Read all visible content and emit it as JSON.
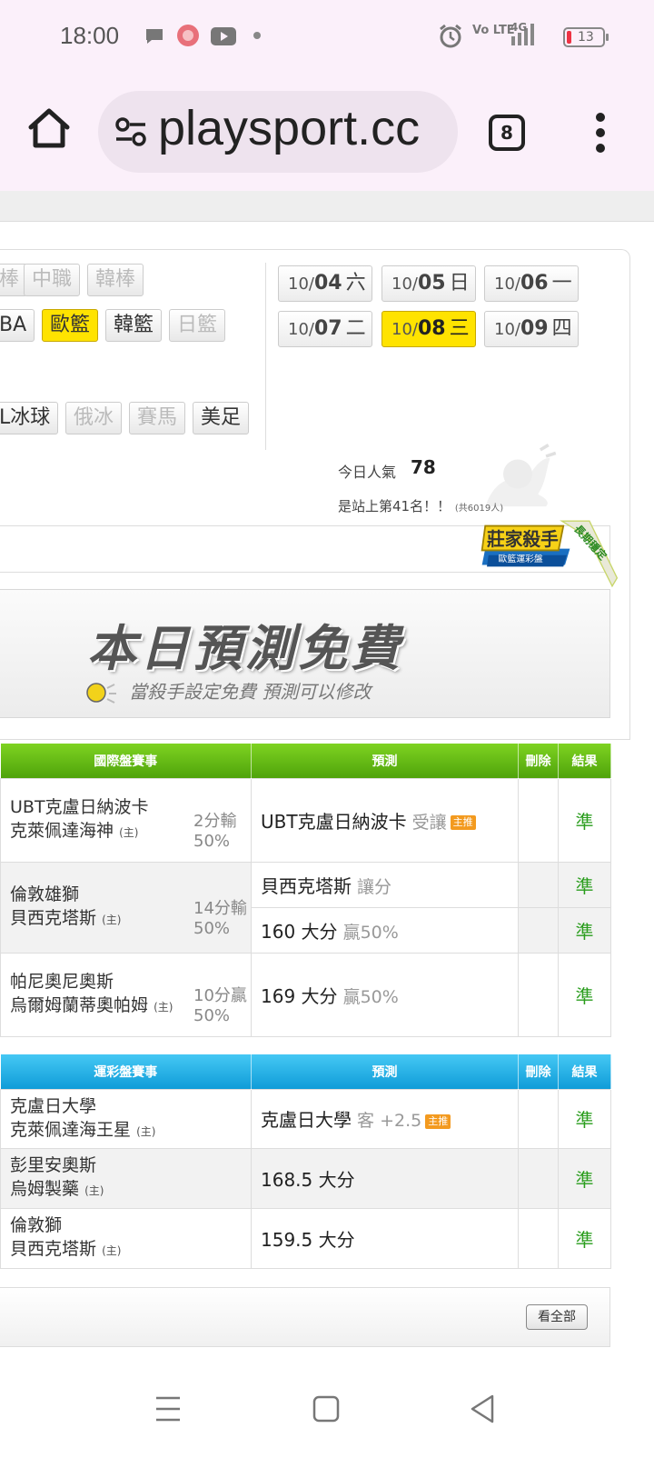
{
  "status_bar": {
    "time": "18:00",
    "battery_level": "13",
    "network": "4G",
    "volte": "Vo LTE",
    "icons": [
      "chat-bubble-icon",
      "app-notification-icon",
      "youtube-icon",
      "dot-icon",
      "alarm-icon",
      "volte-icon",
      "signal-icon",
      "battery-icon"
    ]
  },
  "browser": {
    "url": "playsport.cc",
    "tab_count": "8"
  },
  "sports": {
    "row1": [
      "棒",
      "中職",
      "韓棒"
    ],
    "row2": [
      "BA",
      "歐籃",
      "韓籃",
      "日籃"
    ],
    "row3": [
      "L冰球",
      "俄冰",
      "賽馬",
      "美足"
    ],
    "active": "歐籃"
  },
  "dates": [
    {
      "month": "10/",
      "day": "04",
      "weekday": "六"
    },
    {
      "month": "10/",
      "day": "05",
      "weekday": "日"
    },
    {
      "month": "10/",
      "day": "06",
      "weekday": "一"
    },
    {
      "month": "10/",
      "day": "07",
      "weekday": "二"
    },
    {
      "month": "10/",
      "day": "08",
      "weekday": "三",
      "active": true
    },
    {
      "month": "10/",
      "day": "09",
      "weekday": "四"
    }
  ],
  "popularity": {
    "label": "今日人氣",
    "value": "78",
    "rank_text": "是站上第41名！！",
    "rank_sub": "(共6019人)"
  },
  "badge": {
    "title": "莊家殺手",
    "subtitle": "歐籃運彩盤",
    "ribbon": "長期穩定"
  },
  "banner": {
    "title": "本日預測免費",
    "subtitle": "當殺手設定免費  預測可以修改"
  },
  "intl_table": {
    "headers": [
      "國際盤賽事",
      "預測",
      "刪除",
      "結果"
    ],
    "rows": [
      {
        "team1": "UBT克盧日納波卡",
        "team2": "克萊佩達海神",
        "home": "(主)",
        "score": "2分輸",
        "pct": "50%",
        "predictions": [
          {
            "main": "UBT克盧日納波卡",
            "light": " 受讓",
            "tag": "主推",
            "result": "準"
          }
        ]
      },
      {
        "team1": "倫敦雄獅",
        "team2": "貝西克塔斯",
        "home": "(主)",
        "score": "14分輸",
        "pct": "50%",
        "predictions": [
          {
            "main": "貝西克塔斯",
            "light": " 讓分",
            "tag": "",
            "result": "準"
          },
          {
            "main": "160 大分",
            "light": " 贏50%",
            "tag": "",
            "result": "準"
          }
        ]
      },
      {
        "team1": "帕尼奧尼奧斯",
        "team2": "烏爾姆蘭蒂奧帕姆",
        "home": "(主)",
        "score": "10分贏",
        "pct": "50%",
        "predictions": [
          {
            "main": "169 大分",
            "light": " 贏50%",
            "tag": "",
            "result": "準"
          }
        ]
      }
    ]
  },
  "lottery_table": {
    "headers": [
      "運彩盤賽事",
      "預測",
      "刪除",
      "結果"
    ],
    "rows": [
      {
        "team1": "克盧日大學",
        "team2": "克萊佩達海王星",
        "home": "(主)",
        "pred_main": "克盧日大學",
        "pred_light": " 客 +2.5",
        "tag": "主推",
        "result": "準"
      },
      {
        "team1": "彭里安奧斯",
        "team2": "烏姆製藥",
        "home": "(主)",
        "pred_main": "168.5 大分",
        "pred_light": "",
        "tag": "",
        "result": "準"
      },
      {
        "team1": "倫敦獅",
        "team2": "貝西克塔斯",
        "home": "(主)",
        "pred_main": "159.5 大分",
        "pred_light": "",
        "tag": "",
        "result": "準"
      }
    ]
  },
  "more_button": "看全部",
  "colors": {
    "status_bg": "#fbf0fa",
    "active_yellow": "#ffe300",
    "green_header": "#6cc417",
    "blue_header": "#18aee6",
    "result_green": "#2a9d1d",
    "tag_orange": "#f39a1f"
  }
}
